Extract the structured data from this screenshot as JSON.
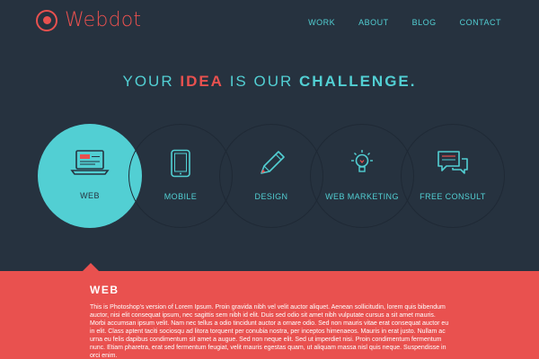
{
  "header": {
    "brand": "Webdot",
    "nav": [
      {
        "label": "WORK"
      },
      {
        "label": "ABOUT"
      },
      {
        "label": "BLOG"
      },
      {
        "label": "CONTACT"
      }
    ]
  },
  "hero": {
    "tagline_1": "YOUR ",
    "tagline_2": "IDEA",
    "tagline_3": " IS OUR ",
    "tagline_4": "CHALLENGE."
  },
  "services": [
    {
      "label": "WEB",
      "icon": "laptop-icon",
      "active": true
    },
    {
      "label": "MOBILE",
      "icon": "tablet-icon",
      "active": false
    },
    {
      "label": "DESIGN",
      "icon": "pencil-icon",
      "active": false
    },
    {
      "label": "WEB MARKETING",
      "icon": "lightbulb-icon",
      "active": false
    },
    {
      "label": "FREE CONSULT",
      "icon": "chat-bubbles-icon",
      "active": false
    }
  ],
  "panel": {
    "title": "WEB",
    "text": "This is Photoshop's version  of Lorem Ipsum. Proin gravida nibh vel velit auctor aliquet. Aenean sollicitudin, lorem quis bibendum auctor, nisi elit consequat ipsum, nec sagittis sem nibh id elit. Duis sed odio sit amet nibh vulputate cursus a sit amet mauris. Morbi accumsan ipsum velit. Nam nec tellus a odio tincidunt auctor a ornare odio. Sed non  mauris vitae erat consequat auctor eu in elit. Class aptent taciti sociosqu ad litora torquent per conubia nostra, per inceptos himenaeos. Mauris in erat justo. Nullam ac urna eu felis dapibus condimentum sit amet a augue. Sed non neque elit. Sed ut imperdiet nisi. Proin condimentum fermentum nunc. Etiam pharetra, erat sed fermentum feugiat, velit mauris egestas quam, ut aliquam massa nisl quis neque. Suspendisse in orci enim."
  },
  "colors": {
    "background": "#26323f",
    "accent": "#52cfd3",
    "brand": "#e9514f"
  }
}
